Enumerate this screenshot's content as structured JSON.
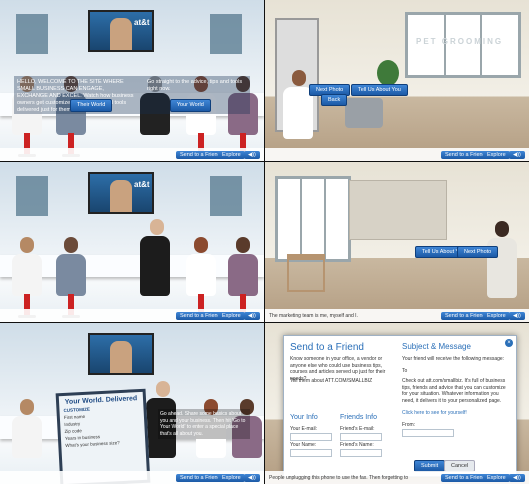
{
  "panel1": {
    "overlay_text": "HELLO, WELCOME TO THE SITE WHERE SMALL BUSINESS CAN ENGAGE, EXCHANGE AND EXCEL. Watch how business owners get customized advice, tips and tools delivered just for them.",
    "overlay_text_right": "Go straight to the advice, tips and tools right now.",
    "btn_left": "Their World",
    "btn_right": "Your World",
    "screen_text": "at&t"
  },
  "panel2": {
    "btn_left": "Next Photo",
    "btn_right": "Tell Us About You",
    "btn_back": "Back",
    "window_text": "PET GROOMING"
  },
  "panel3": {
    "screen_text": "at&t"
  },
  "panel4": {
    "btn_left": "Tell Us About You",
    "btn_right": "Next Photo",
    "caption": "The marketing team is me, myself and I."
  },
  "panel5": {
    "card_title": "Your World. Delivered",
    "card_sub": "CUSTOMIZE",
    "rows": [
      "First name",
      "Industry",
      "Zip code",
      "Years in business",
      "What's your business size?"
    ],
    "speech": "Go ahead. Share some basics about you and your business. Then hit 'Go to Your World' to enter a special place that's all about you."
  },
  "panel6": {
    "title_left": "Send to a Friend",
    "title_right": "Subject & Message",
    "intro": "Know someone in your office, a vendor or anyone else who could use business tips, courses and articles served up just for their needs?",
    "tell": "Tell them about ATT.COM/SMALLBIZ",
    "message": "Your friend will receive the following message:",
    "checkout": "Check out att.com/smallbiz. It's full of business tips, friends and advice that you can customize for your situation. Whatever information you need, it delivers it to your personalized page.",
    "click_here": "Click here to see for yourself!",
    "your_info": "Your Info",
    "friends_info": "Friends Info",
    "your_email": "Your E-mail:",
    "your_name": "Your Name:",
    "friends_email": "Friend's E-mail:",
    "friends_name": "Friend's Name:",
    "to_label": "To",
    "from_label": "From:",
    "submit": "Submit",
    "cancel": "Cancel",
    "caption": "People unplugging this phone to use the fax. Then forgetting to"
  },
  "toolbar": {
    "send": "Send to a Friend",
    "explore": "Explore",
    "mute": "◀))"
  },
  "colors": {
    "accent": "#2a6fb8",
    "button": "#1c5aa6",
    "stool": "#cc2222"
  }
}
